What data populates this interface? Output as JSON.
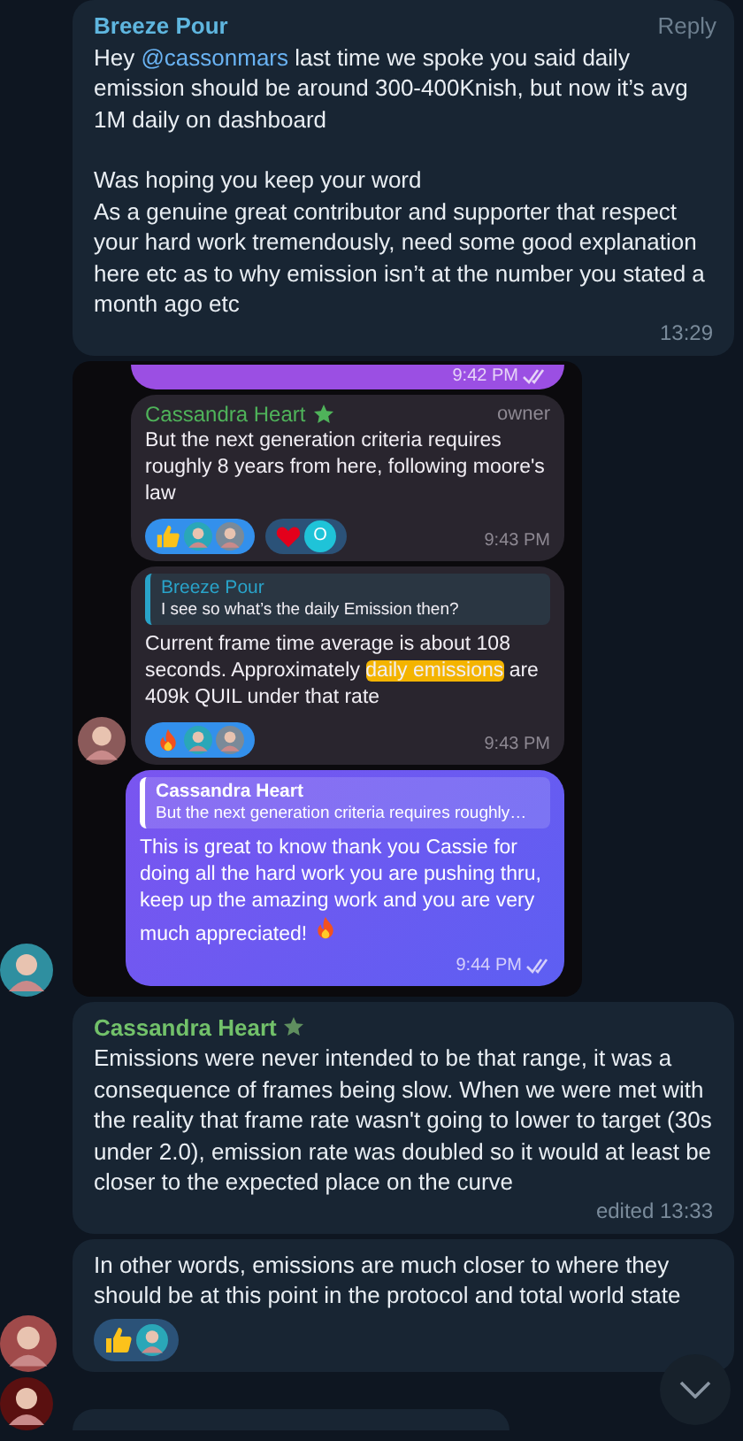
{
  "chat": [
    {
      "kind": "message",
      "author": "Breeze Pour",
      "color": "#5fb6df",
      "action": "Reply",
      "paragraphs": [
        [
          {
            "kind": "plain",
            "text": "Hey "
          },
          {
            "kind": "mention",
            "text": "@cassonmars"
          },
          {
            "kind": "plain",
            "text": " last time we spoke you said daily emission should be around 300-400Knish, but now it’s avg 1M daily on dashboard"
          }
        ],
        [
          {
            "kind": "plain",
            "text": "Was hoping you keep your word\nAs a genuine great contributor and supporter that respect your hard work tremendously, need some good explanation here etc as to why emission isn’t at the number you stated a month ago etc"
          }
        ]
      ],
      "time": "13:29"
    },
    {
      "kind": "screenshot",
      "avatar": true,
      "items": [
        {
          "kind": "stub",
          "time": "9:42 PM",
          "read": true
        },
        {
          "kind": "incoming",
          "author": "Cassandra Heart",
          "color": "#4fb35a",
          "star": true,
          "role": "owner",
          "parts": [
            {
              "kind": "plain",
              "text": "But the next generation criteria requires roughly 8 years from here, following moore's law"
            }
          ],
          "reactions": [
            {
              "kind": "thumbs_up",
              "selected": true
            },
            {
              "kind": "heart",
              "selected": false,
              "avatars": [
                {
                  "kind": "letter",
                  "text": "O",
                  "color": "#1fc3d8"
                }
              ]
            }
          ],
          "time": "9:43 PM"
        },
        {
          "kind": "incoming",
          "avatar": true,
          "quote": {
            "author": "Breeze Pour",
            "text": "I see so what’s the daily Emission then?"
          },
          "parts": [
            {
              "kind": "plain",
              "text": "Current frame time average is about 108 seconds. Approximately "
            },
            {
              "kind": "highlight",
              "text": "daily emissions"
            },
            {
              "kind": "plain",
              "text": " are 409k QUIL under that rate"
            }
          ],
          "reactions": [
            {
              "kind": "fire",
              "selected": true
            }
          ],
          "time": "9:43 PM"
        },
        {
          "kind": "outgoing",
          "quote": {
            "author": "Cassandra Heart",
            "text": "But the next generation criteria requires roughly…"
          },
          "parts": [
            {
              "kind": "plain",
              "text": "This is great to know thank you Cassie for doing all the hard work you are pushing thru, keep up the amazing work and you are very much appreciated! "
            },
            {
              "kind": "fire"
            }
          ],
          "time": "9:44 PM",
          "read": true
        }
      ]
    },
    {
      "kind": "message",
      "author": "Cassandra Heart",
      "color": "#72c16a",
      "star": true,
      "paragraphs": [
        [
          {
            "kind": "plain",
            "text": "Emissions were never intended to be that range, it was a consequence of frames being slow. When we were met with the reality that frame rate wasn't going to lower to target (30s under 2.0), emission rate was doubled so it would at least be closer to the expected place on the curve"
          }
        ]
      ],
      "time": "edited 13:33"
    },
    {
      "kind": "message",
      "avatar": true,
      "paragraphs": [
        [
          {
            "kind": "plain",
            "text": "In other words, emissions are much closer to where they should be at this point in the protocol and total world state"
          }
        ]
      ],
      "reactions": [
        {
          "kind": "thumbs_up",
          "selected": false
        }
      ]
    },
    {
      "kind": "cut_off",
      "avatar": true
    }
  ],
  "scroll_down": true
}
